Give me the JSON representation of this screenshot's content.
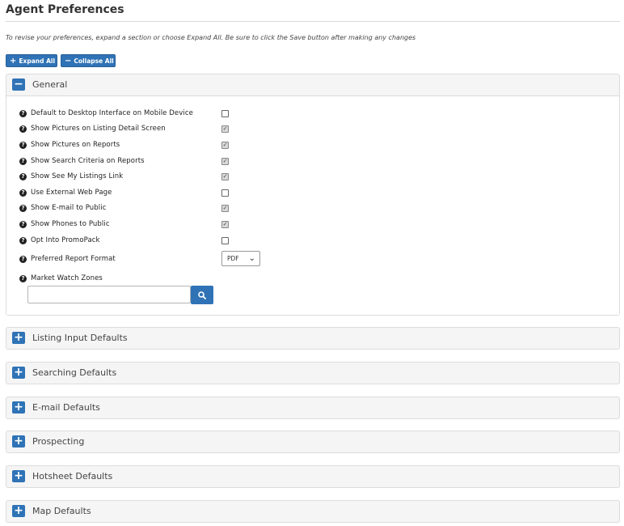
{
  "page": {
    "title": "Agent Preferences",
    "intro": "To revise your preferences, expand a section or choose Expand All. Be sure to click the Save button after making any changes"
  },
  "toolbar": {
    "expand_label": "Expand All",
    "collapse_label": "Collapse All"
  },
  "icons": {
    "plus": "plus-icon",
    "minus": "minus-icon",
    "help": "question-circle-icon",
    "search": "search-icon",
    "chevron": "chevron-down-icon"
  },
  "colors": {
    "accent": "#2f73b6"
  },
  "general": {
    "title": "General",
    "settings": [
      {
        "label": "Default to Desktop Interface on Mobile Device",
        "checked": false
      },
      {
        "label": "Show Pictures on Listing Detail Screen",
        "checked": true
      },
      {
        "label": "Show Pictures on Reports",
        "checked": true
      },
      {
        "label": "Show Search Criteria on Reports",
        "checked": true
      },
      {
        "label": "Show See My Listings Link",
        "checked": true
      },
      {
        "label": "Use External Web Page",
        "checked": false
      },
      {
        "label": "Show E-mail to Public",
        "checked": true
      },
      {
        "label": "Show Phones to Public",
        "checked": true
      },
      {
        "label": "Opt Into PromoPack",
        "checked": false
      }
    ],
    "report_format": {
      "label": "Preferred Report Format",
      "value": "PDF"
    },
    "market_watch": {
      "label": "Market Watch Zones",
      "value": ""
    }
  },
  "sections": [
    {
      "title": "Listing Input Defaults"
    },
    {
      "title": "Searching Defaults"
    },
    {
      "title": "E-mail Defaults"
    },
    {
      "title": "Prospecting"
    },
    {
      "title": "Hotsheet Defaults"
    },
    {
      "title": "Map Defaults"
    }
  ]
}
